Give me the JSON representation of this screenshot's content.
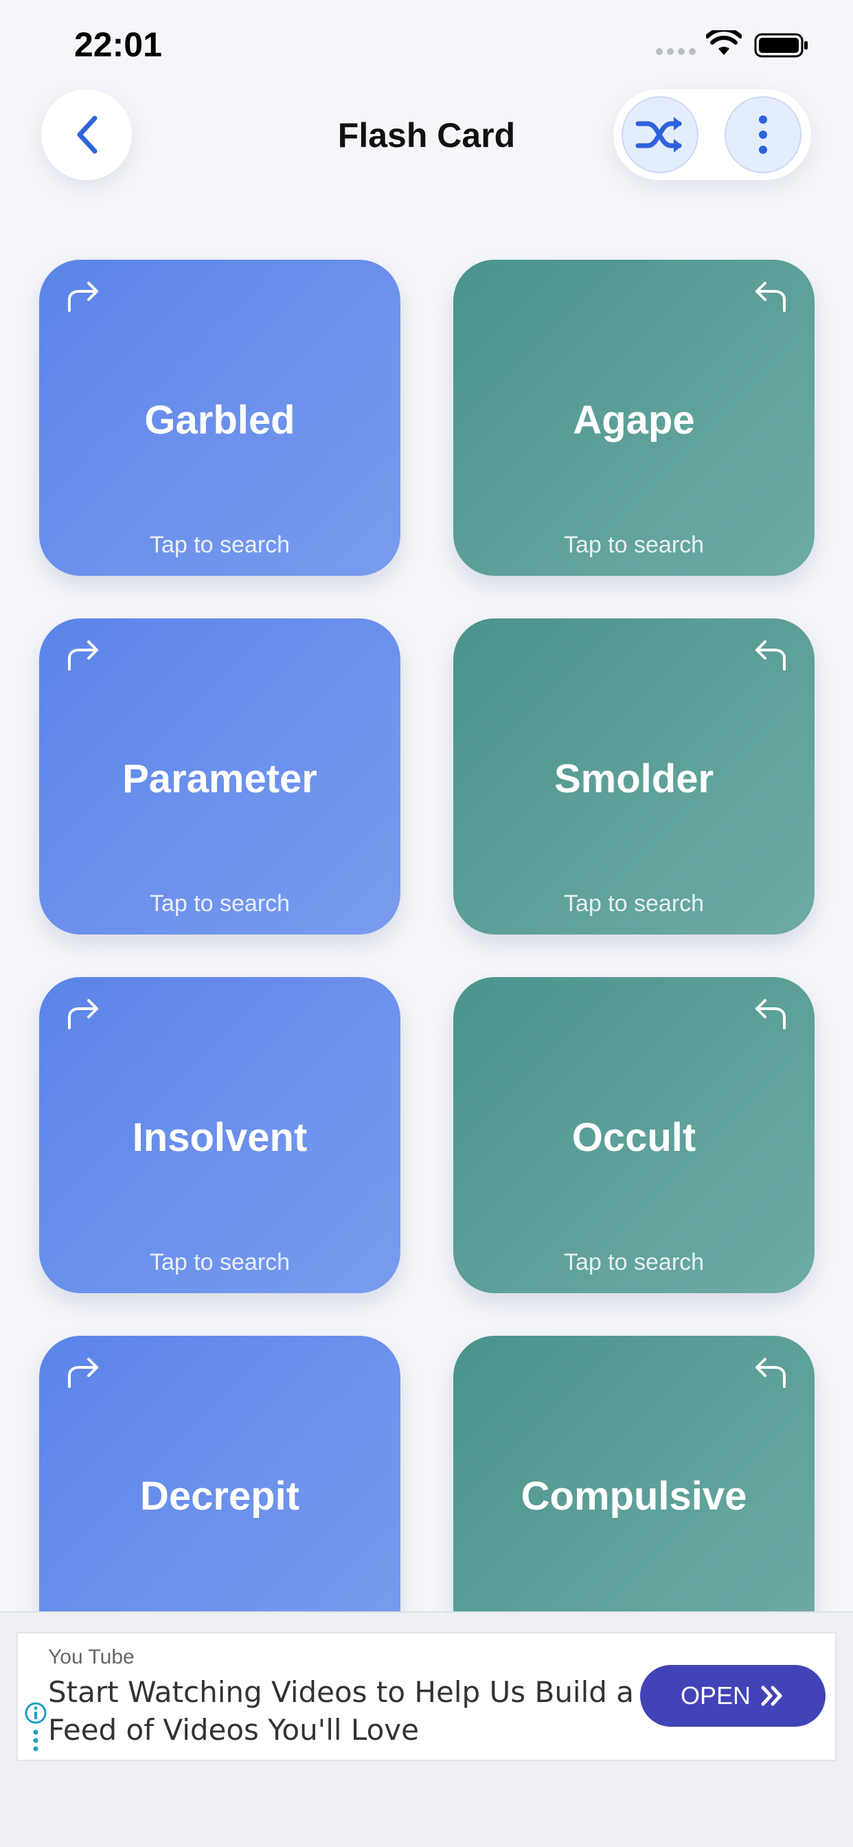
{
  "status_bar": {
    "time": "22:01"
  },
  "header": {
    "title": "Flash Card"
  },
  "cards": [
    {
      "word": "Garbled",
      "hint": "Tap to search",
      "color": "#5b84e9",
      "icon": "forward-arrow-icon"
    },
    {
      "word": "Agape",
      "hint": "Tap to search",
      "color": "#4a938c",
      "icon": "back-arrow-icon"
    },
    {
      "word": "Parameter",
      "hint": "Tap to search",
      "color": "#5b84e9",
      "icon": "forward-arrow-icon"
    },
    {
      "word": "Smolder",
      "hint": "Tap to search",
      "color": "#4a938c",
      "icon": "back-arrow-icon"
    },
    {
      "word": "Insolvent",
      "hint": "Tap to search",
      "color": "#5b84e9",
      "icon": "forward-arrow-icon"
    },
    {
      "word": "Occult",
      "hint": "Tap to search",
      "color": "#4a938c",
      "icon": "back-arrow-icon"
    },
    {
      "word": "Decrepit",
      "color": "#5b84e9",
      "icon": "forward-arrow-icon"
    },
    {
      "word": "Compulsive",
      "color": "#4a938c",
      "icon": "back-arrow-icon"
    }
  ],
  "ad": {
    "source": "You Tube",
    "headline": "Start Watching Videos to Help Us Build a Feed of Videos You'll Love",
    "button_label": "OPEN",
    "button_color": "#4343b8"
  }
}
